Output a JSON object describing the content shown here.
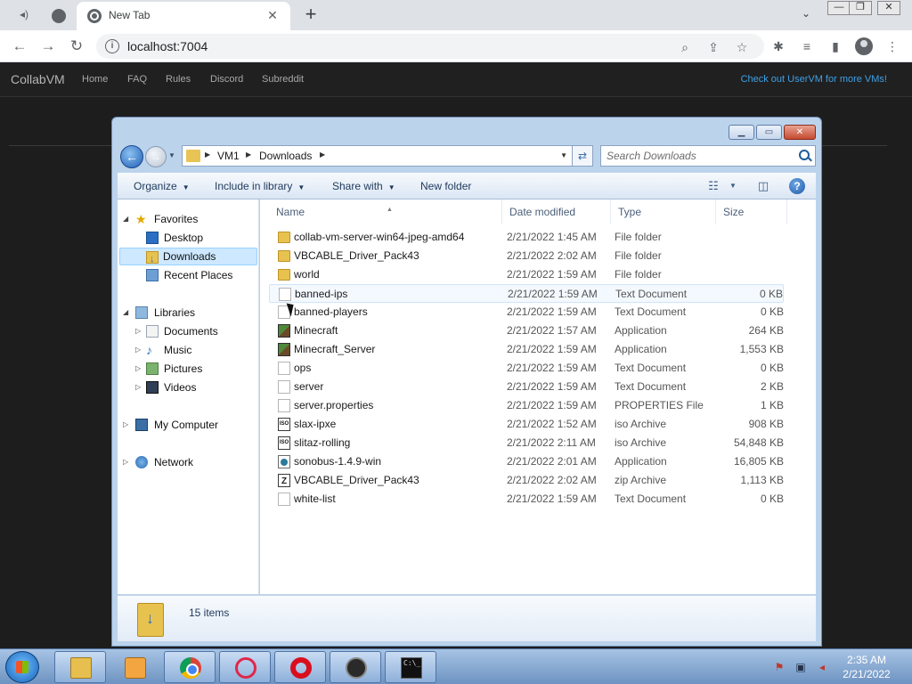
{
  "browser": {
    "tab_title": "New Tab",
    "url": "localhost:7004",
    "window_controls": [
      "—",
      "❐",
      "✕"
    ]
  },
  "collabvm": {
    "brand": "CollabVM",
    "nav": [
      "Home",
      "FAQ",
      "Rules",
      "Discord",
      "Subreddit"
    ],
    "promo": "Check out UserVM for more VMs!"
  },
  "explorer": {
    "breadcrumb": [
      "VM1",
      "Downloads"
    ],
    "search_placeholder": "Search Downloads",
    "commands": [
      "Organize",
      "Include in library",
      "Share with",
      "New folder"
    ],
    "nav": {
      "favorites": "Favorites",
      "favorites_items": [
        "Desktop",
        "Downloads",
        "Recent Places"
      ],
      "libraries": "Libraries",
      "libraries_items": [
        "Documents",
        "Music",
        "Pictures",
        "Videos"
      ],
      "computer": "My Computer",
      "network": "Network"
    },
    "columns": [
      "Name",
      "Date modified",
      "Type",
      "Size"
    ],
    "files": [
      {
        "name": "collab-vm-server-win64-jpeg-amd64",
        "date": "2/21/2022 1:45 AM",
        "type": "File folder",
        "size": "",
        "icon": "folder"
      },
      {
        "name": "VBCABLE_Driver_Pack43",
        "date": "2/21/2022 2:02 AM",
        "type": "File folder",
        "size": "",
        "icon": "folder"
      },
      {
        "name": "world",
        "date": "2/21/2022 1:59 AM",
        "type": "File folder",
        "size": "",
        "icon": "folder"
      },
      {
        "name": "banned-ips",
        "date": "2/21/2022 1:59 AM",
        "type": "Text Document",
        "size": "0 KB",
        "icon": "text"
      },
      {
        "name": "banned-players",
        "date": "2/21/2022 1:59 AM",
        "type": "Text Document",
        "size": "0 KB",
        "icon": "text"
      },
      {
        "name": "Minecraft",
        "date": "2/21/2022 1:57 AM",
        "type": "Application",
        "size": "264 KB",
        "icon": "app"
      },
      {
        "name": "Minecraft_Server",
        "date": "2/21/2022 1:59 AM",
        "type": "Application",
        "size": "1,553 KB",
        "icon": "app"
      },
      {
        "name": "ops",
        "date": "2/21/2022 1:59 AM",
        "type": "Text Document",
        "size": "0 KB",
        "icon": "text"
      },
      {
        "name": "server",
        "date": "2/21/2022 1:59 AM",
        "type": "Text Document",
        "size": "2 KB",
        "icon": "text"
      },
      {
        "name": "server.properties",
        "date": "2/21/2022 1:59 AM",
        "type": "PROPERTIES File",
        "size": "1 KB",
        "icon": "text"
      },
      {
        "name": "slax-ipxe",
        "date": "2/21/2022 1:52 AM",
        "type": "iso Archive",
        "size": "908 KB",
        "icon": "iso"
      },
      {
        "name": "slitaz-rolling",
        "date": "2/21/2022 2:11 AM",
        "type": "iso Archive",
        "size": "54,848 KB",
        "icon": "iso"
      },
      {
        "name": "sonobus-1.4.9-win",
        "date": "2/21/2022 2:01 AM",
        "type": "Application",
        "size": "16,805 KB",
        "icon": "sono"
      },
      {
        "name": "VBCABLE_Driver_Pack43",
        "date": "2/21/2022 2:02 AM",
        "type": "zip Archive",
        "size": "1,113 KB",
        "icon": "zip"
      },
      {
        "name": "white-list",
        "date": "2/21/2022 1:59 AM",
        "type": "Text Document",
        "size": "0 KB",
        "icon": "text"
      }
    ],
    "item_count": "15 items",
    "iso_label": "ISO"
  },
  "taskbar": {
    "time": "2:35 AM",
    "date": "2/21/2022",
    "cmd_label": "C:\\_"
  }
}
